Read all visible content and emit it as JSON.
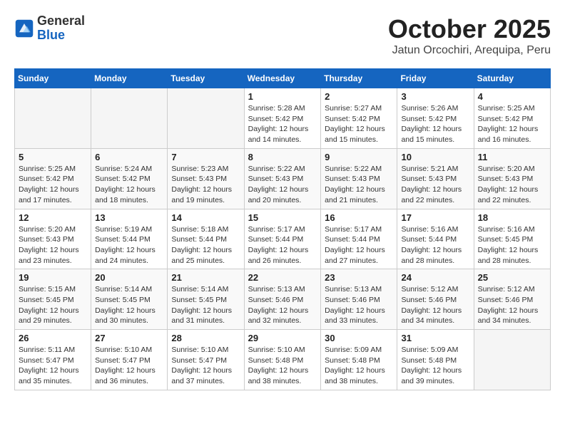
{
  "header": {
    "logo_general": "General",
    "logo_blue": "Blue",
    "month_title": "October 2025",
    "location": "Jatun Orcochiri, Arequipa, Peru"
  },
  "days_of_week": [
    "Sunday",
    "Monday",
    "Tuesday",
    "Wednesday",
    "Thursday",
    "Friday",
    "Saturday"
  ],
  "weeks": [
    [
      {
        "day": "",
        "info": ""
      },
      {
        "day": "",
        "info": ""
      },
      {
        "day": "",
        "info": ""
      },
      {
        "day": "1",
        "info": "Sunrise: 5:28 AM\nSunset: 5:42 PM\nDaylight: 12 hours and 14 minutes."
      },
      {
        "day": "2",
        "info": "Sunrise: 5:27 AM\nSunset: 5:42 PM\nDaylight: 12 hours and 15 minutes."
      },
      {
        "day": "3",
        "info": "Sunrise: 5:26 AM\nSunset: 5:42 PM\nDaylight: 12 hours and 15 minutes."
      },
      {
        "day": "4",
        "info": "Sunrise: 5:25 AM\nSunset: 5:42 PM\nDaylight: 12 hours and 16 minutes."
      }
    ],
    [
      {
        "day": "5",
        "info": "Sunrise: 5:25 AM\nSunset: 5:42 PM\nDaylight: 12 hours and 17 minutes."
      },
      {
        "day": "6",
        "info": "Sunrise: 5:24 AM\nSunset: 5:42 PM\nDaylight: 12 hours and 18 minutes."
      },
      {
        "day": "7",
        "info": "Sunrise: 5:23 AM\nSunset: 5:43 PM\nDaylight: 12 hours and 19 minutes."
      },
      {
        "day": "8",
        "info": "Sunrise: 5:22 AM\nSunset: 5:43 PM\nDaylight: 12 hours and 20 minutes."
      },
      {
        "day": "9",
        "info": "Sunrise: 5:22 AM\nSunset: 5:43 PM\nDaylight: 12 hours and 21 minutes."
      },
      {
        "day": "10",
        "info": "Sunrise: 5:21 AM\nSunset: 5:43 PM\nDaylight: 12 hours and 22 minutes."
      },
      {
        "day": "11",
        "info": "Sunrise: 5:20 AM\nSunset: 5:43 PM\nDaylight: 12 hours and 22 minutes."
      }
    ],
    [
      {
        "day": "12",
        "info": "Sunrise: 5:20 AM\nSunset: 5:43 PM\nDaylight: 12 hours and 23 minutes."
      },
      {
        "day": "13",
        "info": "Sunrise: 5:19 AM\nSunset: 5:44 PM\nDaylight: 12 hours and 24 minutes."
      },
      {
        "day": "14",
        "info": "Sunrise: 5:18 AM\nSunset: 5:44 PM\nDaylight: 12 hours and 25 minutes."
      },
      {
        "day": "15",
        "info": "Sunrise: 5:17 AM\nSunset: 5:44 PM\nDaylight: 12 hours and 26 minutes."
      },
      {
        "day": "16",
        "info": "Sunrise: 5:17 AM\nSunset: 5:44 PM\nDaylight: 12 hours and 27 minutes."
      },
      {
        "day": "17",
        "info": "Sunrise: 5:16 AM\nSunset: 5:44 PM\nDaylight: 12 hours and 28 minutes."
      },
      {
        "day": "18",
        "info": "Sunrise: 5:16 AM\nSunset: 5:45 PM\nDaylight: 12 hours and 28 minutes."
      }
    ],
    [
      {
        "day": "19",
        "info": "Sunrise: 5:15 AM\nSunset: 5:45 PM\nDaylight: 12 hours and 29 minutes."
      },
      {
        "day": "20",
        "info": "Sunrise: 5:14 AM\nSunset: 5:45 PM\nDaylight: 12 hours and 30 minutes."
      },
      {
        "day": "21",
        "info": "Sunrise: 5:14 AM\nSunset: 5:45 PM\nDaylight: 12 hours and 31 minutes."
      },
      {
        "day": "22",
        "info": "Sunrise: 5:13 AM\nSunset: 5:46 PM\nDaylight: 12 hours and 32 minutes."
      },
      {
        "day": "23",
        "info": "Sunrise: 5:13 AM\nSunset: 5:46 PM\nDaylight: 12 hours and 33 minutes."
      },
      {
        "day": "24",
        "info": "Sunrise: 5:12 AM\nSunset: 5:46 PM\nDaylight: 12 hours and 34 minutes."
      },
      {
        "day": "25",
        "info": "Sunrise: 5:12 AM\nSunset: 5:46 PM\nDaylight: 12 hours and 34 minutes."
      }
    ],
    [
      {
        "day": "26",
        "info": "Sunrise: 5:11 AM\nSunset: 5:47 PM\nDaylight: 12 hours and 35 minutes."
      },
      {
        "day": "27",
        "info": "Sunrise: 5:10 AM\nSunset: 5:47 PM\nDaylight: 12 hours and 36 minutes."
      },
      {
        "day": "28",
        "info": "Sunrise: 5:10 AM\nSunset: 5:47 PM\nDaylight: 12 hours and 37 minutes."
      },
      {
        "day": "29",
        "info": "Sunrise: 5:10 AM\nSunset: 5:48 PM\nDaylight: 12 hours and 38 minutes."
      },
      {
        "day": "30",
        "info": "Sunrise: 5:09 AM\nSunset: 5:48 PM\nDaylight: 12 hours and 38 minutes."
      },
      {
        "day": "31",
        "info": "Sunrise: 5:09 AM\nSunset: 5:48 PM\nDaylight: 12 hours and 39 minutes."
      },
      {
        "day": "",
        "info": ""
      }
    ]
  ]
}
